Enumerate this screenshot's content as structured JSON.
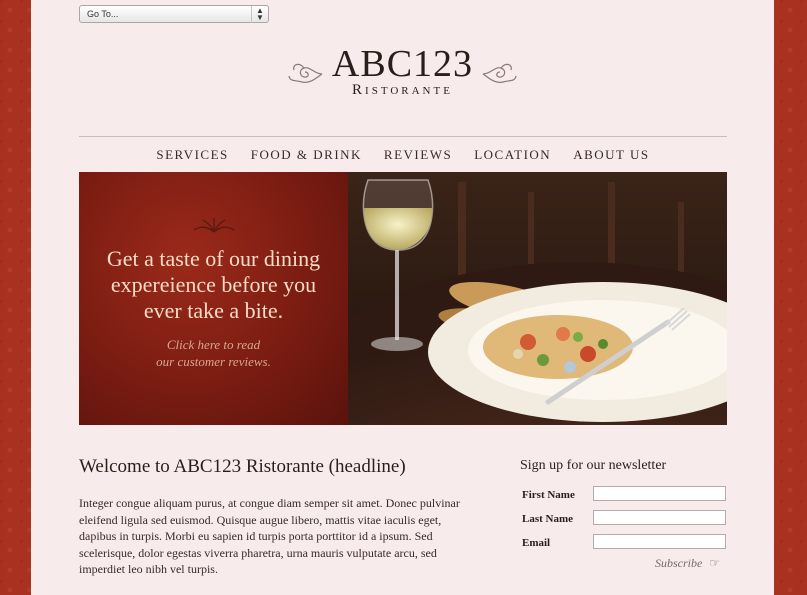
{
  "goto_select": {
    "value": "Go To..."
  },
  "logo": {
    "main": "ABC123",
    "sub": "Ristorante"
  },
  "nav": [
    "SERVICES",
    "FOOD & DRINK",
    "REVIEWS",
    "LOCATION",
    "ABOUT US"
  ],
  "hero": {
    "title_lines": [
      "Get a taste of our dining",
      "expereience before you",
      "ever take a bite."
    ],
    "cta_lines": [
      "Click here to read",
      "our customer reviews."
    ]
  },
  "main": {
    "headline": "Welcome to ABC123 Ristorante (headline)",
    "body": "Integer congue aliquam purus, at congue diam semper sit amet. Donec pulvinar eleifend ligula sed euismod. Quisque augue libero, mattis vitae iaculis eget, dapibus in turpis. Morbi eu sapien id turpis porta porttitor id a ipsum. Sed scelerisque, dolor egestas viverra pharetra, urna mauris vulputate arcu, sed imperdiet leo nibh vel turpis."
  },
  "newsletter": {
    "title": "Sign up for our newsletter",
    "first_name_label": "First Name",
    "last_name_label": "Last Name",
    "email_label": "Email",
    "subscribe_label": "Subscribe",
    "subscribe_icon": "pointing-hand-icon"
  },
  "colors": {
    "background": "#a8321f",
    "page": "#f7ebeb",
    "hero_red": "#7a1c12",
    "hero_text": "#f7dcc6"
  }
}
